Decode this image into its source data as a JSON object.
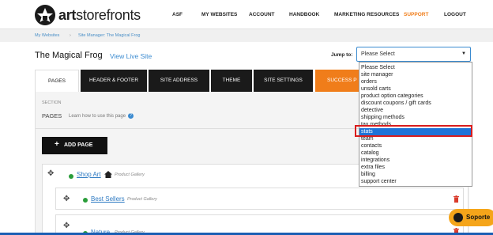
{
  "brand": {
    "logo_text_bold": "art",
    "logo_text": "storefronts"
  },
  "nav": {
    "items": [
      "ASF",
      "MY WEBSITES",
      "ACCOUNT",
      "HANDBOOK",
      "MARKETING RESOURCES",
      "SUPPORT",
      "LOGOUT"
    ],
    "active": "SUPPORT"
  },
  "breadcrumb": {
    "home": "My Websites",
    "sep": "›",
    "current": "Site Manager: The Magical Frog"
  },
  "page": {
    "title": "The Magical Frog",
    "view_live": "View Live Site"
  },
  "jump": {
    "label": "Jump to:",
    "selected": "Please Select"
  },
  "tabs": [
    "PAGES",
    "HEADER & FOOTER",
    "SITE ADDRESS",
    "THEME",
    "SITE SETTINGS",
    "SUCCESS P"
  ],
  "section": {
    "label": "SECTION",
    "name": "PAGES",
    "learn": "Learn how to use this page"
  },
  "add_page": {
    "plus": "+",
    "label": "ADD PAGE"
  },
  "rows": [
    {
      "name": "Shop Art",
      "type": "Product Gallery"
    },
    {
      "name": "Best Sellers",
      "type": "Product Gallery"
    },
    {
      "name": "Nature",
      "type": "Product Gallery"
    }
  ],
  "dropdown": {
    "options": [
      "Please Select",
      "site manager",
      "orders",
      "unsold carts",
      "product option categories",
      "discount coupons / gift cards",
      "detective",
      "shipping methods",
      "tax methods",
      "stats",
      "team",
      "contacts",
      "catalog",
      "integrations",
      "extra files",
      "billing",
      "support center"
    ],
    "highlighted": "stats"
  },
  "support_chip": {
    "label": "Soporte"
  },
  "colors": {
    "accent": "#f07d1a",
    "link": "#3b8bd0",
    "selection": "#1e73d8",
    "highlight": "#d91c1c",
    "status": "#2a9d3a"
  }
}
